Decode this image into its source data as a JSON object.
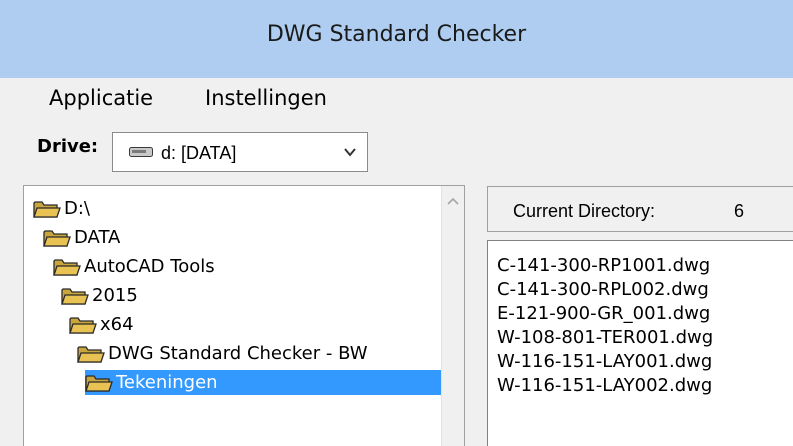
{
  "window": {
    "title": "DWG Standard Checker"
  },
  "menu": [
    {
      "label": "Applicatie"
    },
    {
      "label": "Instellingen"
    }
  ],
  "drive": {
    "label": "Drive:",
    "selected": "d: [DATA]",
    "icon": "drive-icon"
  },
  "tree": {
    "items": [
      {
        "label": "D:\\",
        "icon": "folder-open-icon",
        "selected": false
      },
      {
        "label": "DATA",
        "icon": "folder-open-icon",
        "selected": false
      },
      {
        "label": "AutoCAD Tools",
        "icon": "folder-open-icon",
        "selected": false
      },
      {
        "label": "2015",
        "icon": "folder-open-icon",
        "selected": false
      },
      {
        "label": "x64",
        "icon": "folder-open-icon",
        "selected": false
      },
      {
        "label": "DWG Standard Checker - BW",
        "icon": "folder-open-icon",
        "selected": false
      },
      {
        "label": "Tekeningen",
        "icon": "folder-open-icon",
        "selected": true
      }
    ]
  },
  "current_directory": {
    "label": "Current Directory:",
    "count": "6"
  },
  "files": [
    "C-141-300-RP1001.dwg",
    "C-141-300-RPL002.dwg",
    "E-121-900-GR_001.dwg",
    "W-108-801-TER001.dwg",
    "W-116-151-LAY001.dwg",
    "W-116-151-LAY002.dwg"
  ],
  "colors": {
    "titlebar": "#aecdf0",
    "selection": "#3399ff",
    "folder": "#e8c252"
  }
}
